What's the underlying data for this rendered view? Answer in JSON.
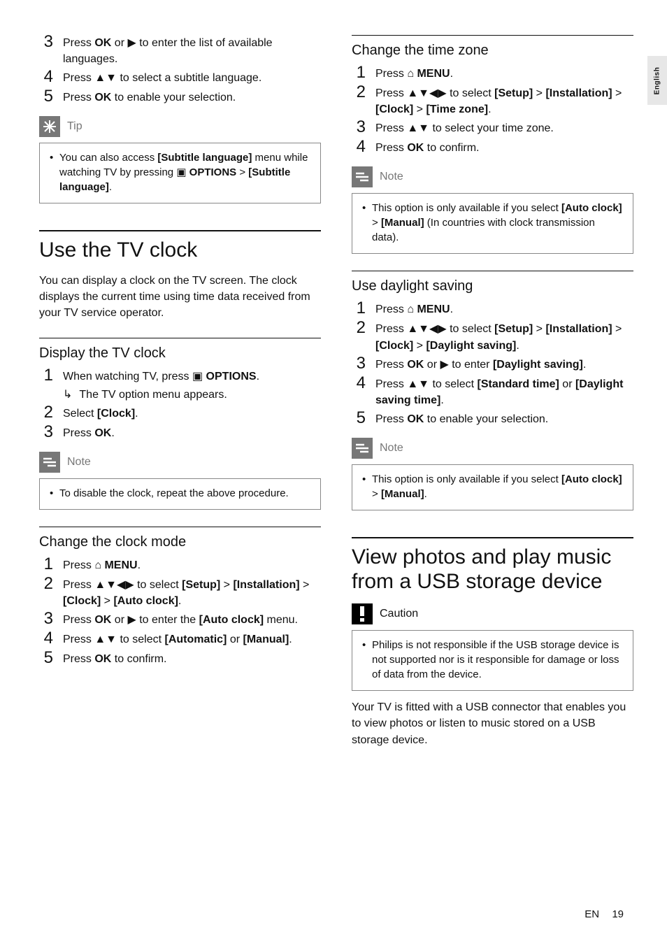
{
  "side_tab": "English",
  "left": {
    "steps_top": [
      {
        "n": "3",
        "pre": "Press ",
        "b1": "OK",
        "mid": " or ",
        "sym": "▶",
        "post": " to enter the list of available languages."
      },
      {
        "n": "4",
        "pre": "Press ",
        "sym": "▲▼",
        "post": " to select a subtitle language."
      },
      {
        "n": "5",
        "pre": "Press ",
        "b1": "OK",
        "post": " to enable your selection."
      }
    ],
    "tip_label": "Tip",
    "tip_body_pre": "You can also access ",
    "tip_body_b1": "[Subtitle language]",
    "tip_body_mid1": " menu while watching TV by pressing ",
    "tip_body_icon": "▣",
    "tip_body_b2": " OPTIONS",
    "tip_body_mid2": " > ",
    "tip_body_b3": "[Subtitle language]",
    "tip_body_end": ".",
    "h1": "Use the TV clock",
    "intro": "You can display a clock on the TV screen. The clock displays the current time using time data received from your TV service operator.",
    "h2a": "Display the TV clock",
    "steps_a": [
      {
        "n": "1",
        "pre": "When watching TV, press ",
        "icon": "▣",
        "b1": " OPTIONS",
        "post": ".",
        "sub": "The TV option menu appears."
      },
      {
        "n": "2",
        "pre": "Select ",
        "b1": "[Clock]",
        "post": "."
      },
      {
        "n": "3",
        "pre": "Press ",
        "b1": "OK",
        "post": "."
      }
    ],
    "note_a_label": "Note",
    "note_a_body": "To disable the clock, repeat the above procedure.",
    "h2b": "Change the clock mode",
    "steps_b": [
      {
        "n": "1",
        "pre": "Press ",
        "icon": "⌂",
        "b1": " MENU",
        "post": "."
      },
      {
        "n": "2",
        "pre": "Press ",
        "sym": "▲▼◀▶",
        "mid": " to select ",
        "b1": "[Setup]",
        "mid2": " > ",
        "b2": "[Installation]",
        "mid3": " > ",
        "b3": "[Clock]",
        "mid4": " > ",
        "b4": "[Auto clock]",
        "post": "."
      },
      {
        "n": "3",
        "pre": "Press ",
        "b1": "OK",
        "mid": " or ",
        "sym": "▶",
        "mid2": " to enter the ",
        "b2": "[Auto clock]",
        "post": " menu."
      },
      {
        "n": "4",
        "pre": "Press ",
        "sym": "▲▼",
        "mid": " to select ",
        "b1": "[Automatic]",
        "mid2": " or ",
        "b2": "[Manual]",
        "post": "."
      },
      {
        "n": "5",
        "pre": "Press ",
        "b1": "OK",
        "post": " to confirm."
      }
    ]
  },
  "right": {
    "h2a": "Change the time zone",
    "steps_a": [
      {
        "n": "1",
        "pre": "Press ",
        "icon": "⌂",
        "b1": " MENU",
        "post": "."
      },
      {
        "n": "2",
        "pre": "Press ",
        "sym": "▲▼◀▶",
        "mid": " to select ",
        "b1": "[Setup]",
        "mid2": " > ",
        "b2": "[Installation]",
        "mid3": " > ",
        "b3": "[Clock]",
        "mid4": " > ",
        "b4": "[Time zone]",
        "post": "."
      },
      {
        "n": "3",
        "pre": "Press ",
        "sym": "▲▼",
        "post": " to select your time zone."
      },
      {
        "n": "4",
        "pre": "Press ",
        "b1": "OK",
        "post": " to confirm."
      }
    ],
    "note_a_label": "Note",
    "note_a_pre": "This option is only available if you select ",
    "note_a_b1": "[Auto clock]",
    "note_a_mid": " > ",
    "note_a_b2": "[Manual]",
    "note_a_post": " (In countries with clock transmission data).",
    "h2b": "Use daylight saving",
    "steps_b": [
      {
        "n": "1",
        "pre": "Press ",
        "icon": "⌂",
        "b1": " MENU",
        "post": "."
      },
      {
        "n": "2",
        "pre": "Press ",
        "sym": "▲▼◀▶",
        "mid": " to select ",
        "b1": "[Setup]",
        "mid2": " > ",
        "b2": "[Installation]",
        "mid3": " > ",
        "b3": "[Clock]",
        "mid4": " > ",
        "b4": "[Daylight saving]",
        "post": "."
      },
      {
        "n": "3",
        "pre": "Press ",
        "b1": "OK",
        "mid": " or ",
        "sym": "▶",
        "mid2": " to enter ",
        "b2": "[Daylight saving]",
        "post": "."
      },
      {
        "n": "4",
        "pre": "Press ",
        "sym": "▲▼",
        "mid": " to select ",
        "b1": "[Standard time]",
        "mid2": " or ",
        "b2": "[Daylight saving time]",
        "post": "."
      },
      {
        "n": "5",
        "pre": "Press ",
        "b1": "OK",
        "post": " to enable your selection."
      }
    ],
    "note_b_label": "Note",
    "note_b_pre": "This option is only available if you select ",
    "note_b_b1": "[Auto clock]",
    "note_b_mid": " > ",
    "note_b_b2": "[Manual]",
    "note_b_post": ".",
    "h1": "View photos and play music from a USB storage device",
    "caution_label": "Caution",
    "caution_body": "Philips is not responsible if the USB storage device is not supported nor is it responsible for damage or loss of data from the device.",
    "outro": "Your TV is fitted with a USB connector that enables you to view photos or listen to music stored on a USB storage device."
  },
  "footer": {
    "lang": "EN",
    "page": "19"
  }
}
